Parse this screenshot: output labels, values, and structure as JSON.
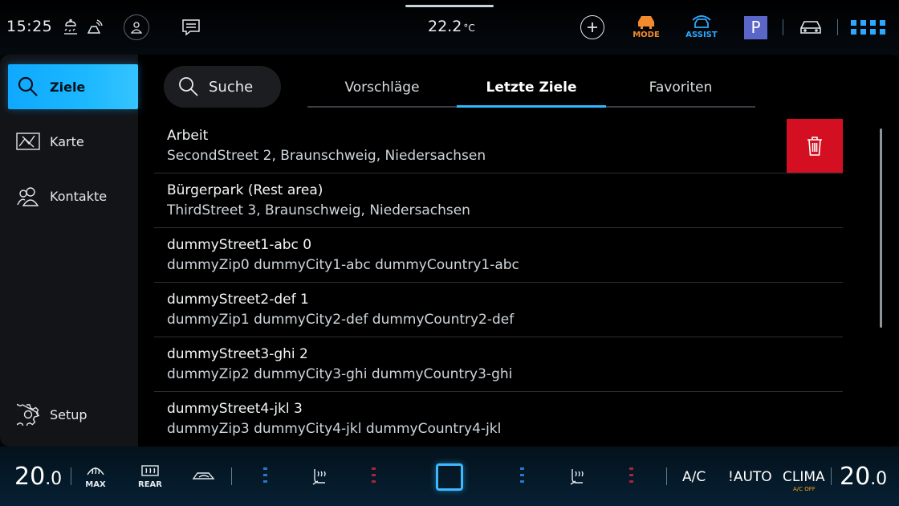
{
  "status_bar": {
    "time": "15:25",
    "temperature": "22.2",
    "temperature_unit": "°C",
    "mode_label": "MODE",
    "assist_label": "ASSIST",
    "parking_label": "P",
    "icons": [
      "weather-icon",
      "connectivity-icon",
      "profile-icon",
      "message-icon",
      "add-icon",
      "mode-car-icon",
      "assist-car-icon",
      "parking-icon",
      "car-icon",
      "apps-grid-icon"
    ]
  },
  "sidebar": {
    "items": [
      {
        "label": "Ziele",
        "icon": "search-icon",
        "active": true
      },
      {
        "label": "Karte",
        "icon": "map-icon",
        "active": false
      },
      {
        "label": "Kontakte",
        "icon": "contacts-icon",
        "active": false
      },
      {
        "label": "Setup",
        "icon": "gear-icon",
        "active": false
      }
    ]
  },
  "search": {
    "label": "Suche"
  },
  "tabs": [
    {
      "label": "Vorschläge",
      "active": false
    },
    {
      "label": "Letzte Ziele",
      "active": true
    },
    {
      "label": "Favoriten",
      "active": false
    }
  ],
  "destinations": [
    {
      "title": "Arbeit",
      "address": "SecondStreet 2, Braunschweig, Niedersachsen"
    },
    {
      "title": "Bürgerpark (Rest area)",
      "address": "ThirdStreet 3, Braunschweig, Niedersachsen"
    },
    {
      "title": "dummyStreet1-abc 0",
      "address": "dummyZip0 dummyCity1-abc dummyCountry1-abc"
    },
    {
      "title": "dummyStreet2-def 1",
      "address": "dummyZip1 dummyCity2-def dummyCountry2-def"
    },
    {
      "title": "dummyStreet3-ghi 2",
      "address": "dummyZip2 dummyCity3-ghi dummyCountry3-ghi"
    },
    {
      "title": "dummyStreet4-jkl 3",
      "address": "dummyZip3 dummyCity4-jkl dummyCountry4-jkl"
    }
  ],
  "climate": {
    "left_temp_int": "20",
    "left_temp_dec": ".0",
    "right_temp_int": "20",
    "right_temp_dec": ".0",
    "max_label": "MAX",
    "rear_label": "REAR",
    "ac_label": "A/C",
    "auto_label": "!AUTO",
    "clima_label": "CLIMA",
    "clima_sub": "A/C OFF"
  },
  "colors": {
    "accent": "#1cb8ff",
    "delete": "#d40f22",
    "mode_orange": "#f28a2e",
    "assist_blue": "#2ea8ff",
    "parking_purple": "#5a67c9"
  }
}
